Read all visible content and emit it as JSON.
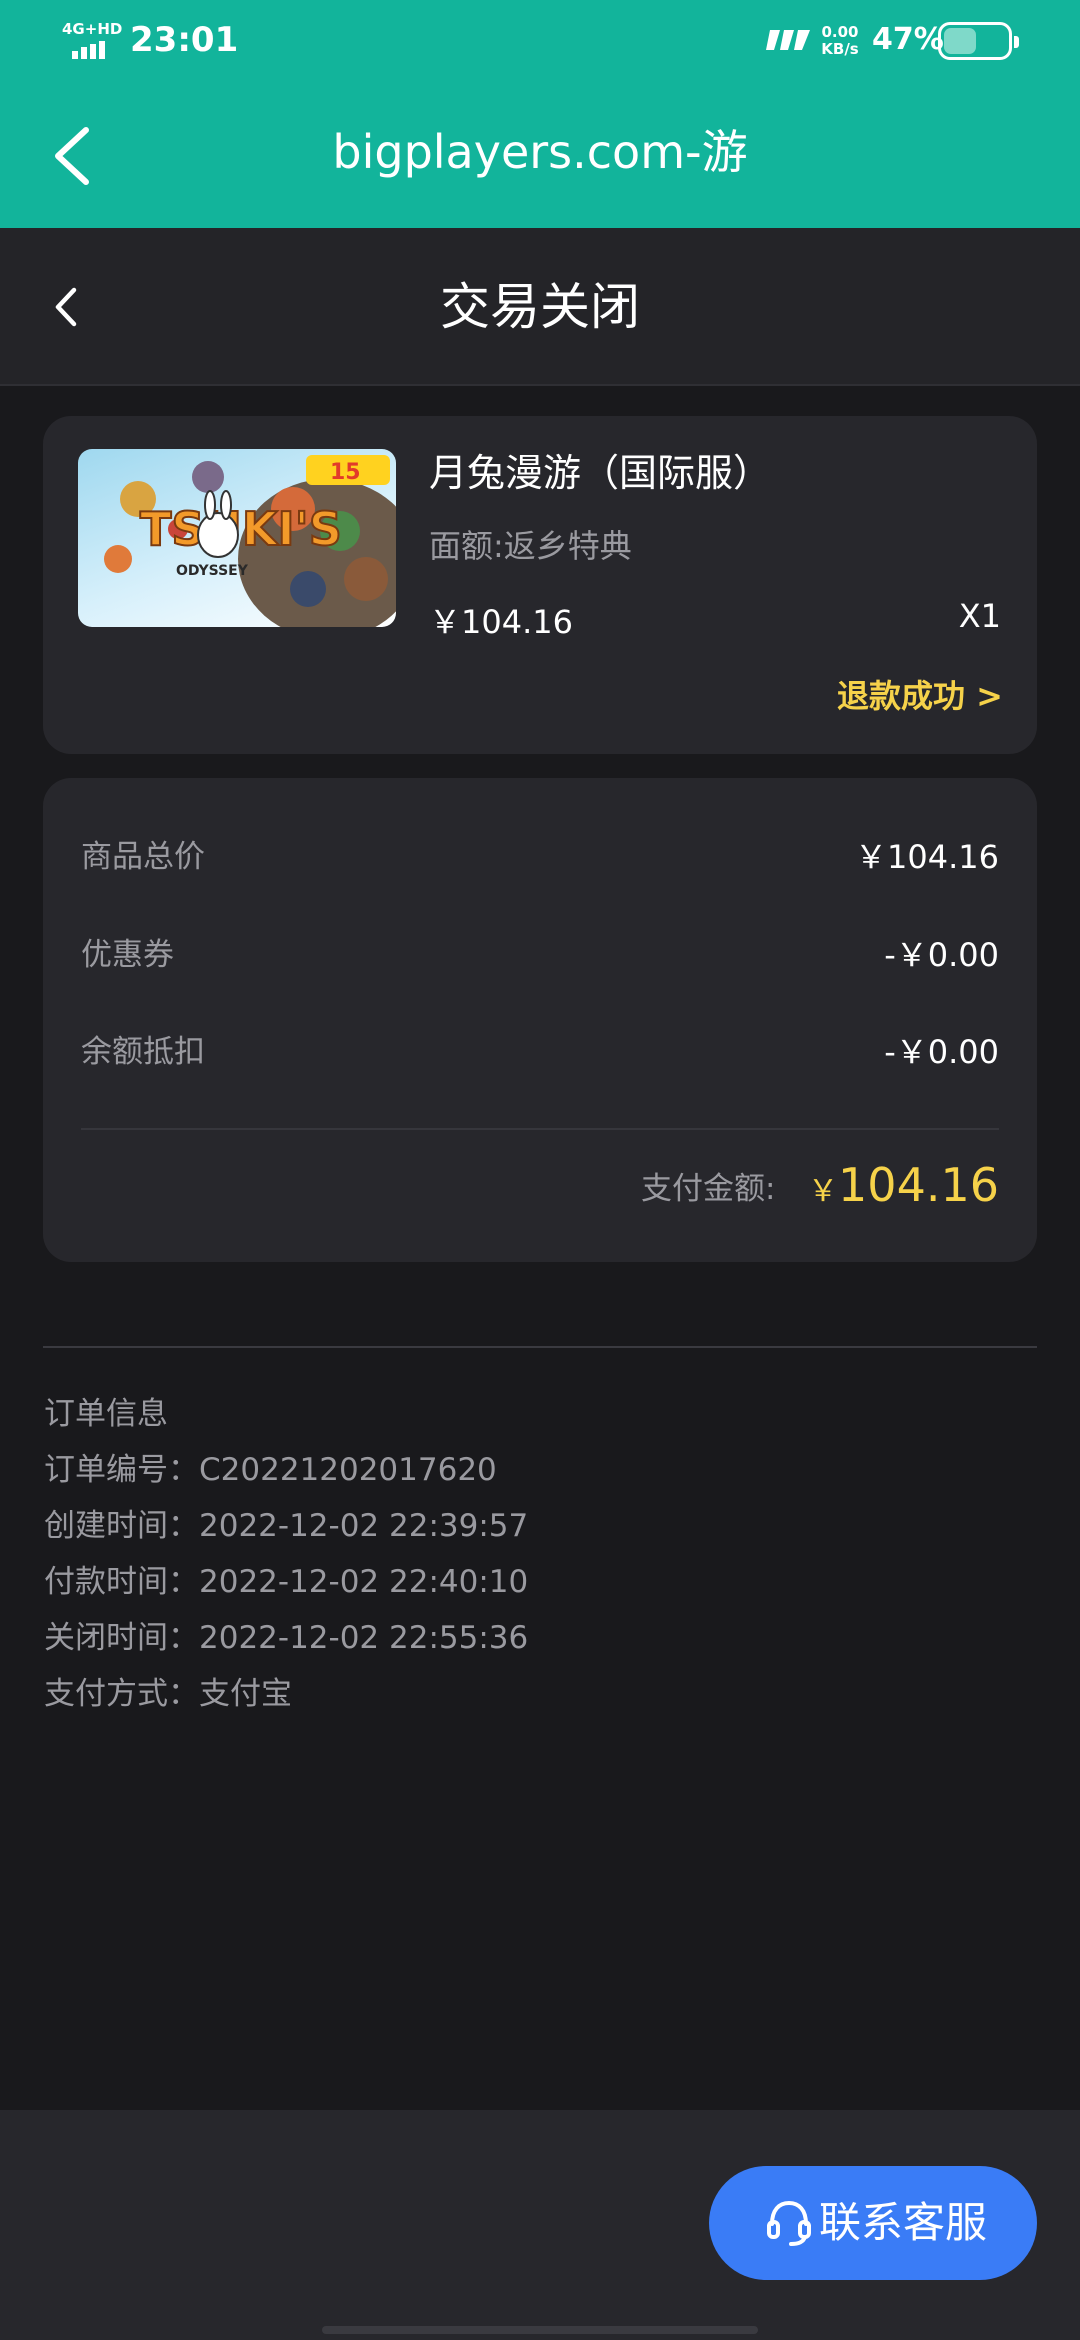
{
  "status_bar": {
    "network": "4G+HD",
    "time": "23:01",
    "speed_value": "0.00",
    "speed_unit": "KB/s",
    "battery": "47%"
  },
  "browser": {
    "title": "bigplayers.com-游"
  },
  "header": {
    "title": "交易关闭"
  },
  "product": {
    "name": "月兔漫游（国际服）",
    "spec": "面额:返乡特典",
    "price": "￥104.16",
    "quantity": "X1",
    "refund_status": "退款成功 >",
    "image_title": "TSUKI'S",
    "image_subtitle": "ODYSSEY",
    "image_badge": "15"
  },
  "summary": {
    "rows": [
      {
        "label": "商品总价",
        "value": "￥104.16"
      },
      {
        "label": "优惠券",
        "value": "-￥0.00"
      },
      {
        "label": "余额抵扣",
        "value": "-￥0.00"
      }
    ],
    "pay_label": "支付金额:",
    "pay_currency": "￥",
    "pay_amount": "104.16"
  },
  "order_info": {
    "heading": "订单信息",
    "lines": [
      "订单编号：C20221202017620",
      "创建时间：2022-12-02 22:39:57",
      "付款时间：2022-12-02 22:40:10",
      "关闭时间：2022-12-02 22:55:36",
      "支付方式：支付宝"
    ]
  },
  "footer": {
    "contact_label": "联系客服"
  },
  "colors": {
    "accent_teal": "#12b49b",
    "highlight_yellow": "#f6d24a",
    "button_blue": "#3a7cf6"
  }
}
